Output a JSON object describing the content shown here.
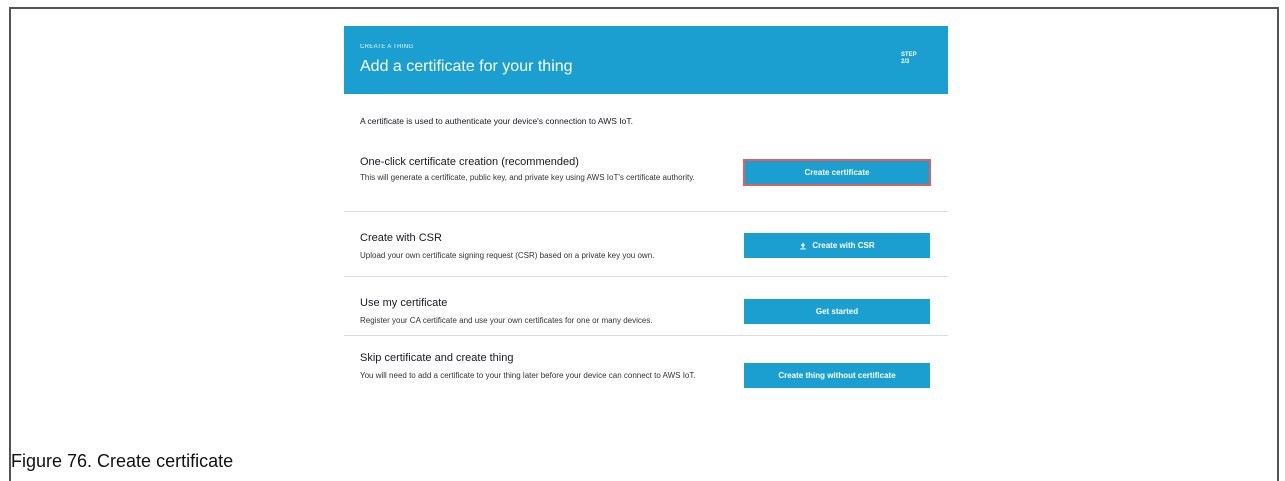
{
  "header": {
    "kicker": "CREATE A THING",
    "title": "Add a certificate for your thing",
    "step_label": "STEP",
    "step_value": "2/3"
  },
  "intro": "A certificate is used to authenticate your device's connection to AWS IoT.",
  "options": [
    {
      "title": "One-click certificate creation (recommended)",
      "description": "This will generate a certificate, public key, and private key using AWS IoT's certificate authority.",
      "button": "Create certificate"
    },
    {
      "title": "Create with CSR",
      "description": "Upload your own certificate signing request (CSR) based on a private key you own.",
      "button": "Create with CSR"
    },
    {
      "title": "Use my certificate",
      "description": "Register your CA certificate and use your own certificates for one or many devices.",
      "button": "Get started"
    },
    {
      "title": "Skip certificate and create thing",
      "description": "You will need to add a certificate to your thing later before your device can connect to AWS IoT.",
      "button": "Create thing without certificate"
    }
  ],
  "caption": "Figure 76.  Create certificate",
  "colors": {
    "accent": "#1a9fd0",
    "highlight": "#e06060"
  },
  "icons": {
    "upload": "upload-icon"
  }
}
